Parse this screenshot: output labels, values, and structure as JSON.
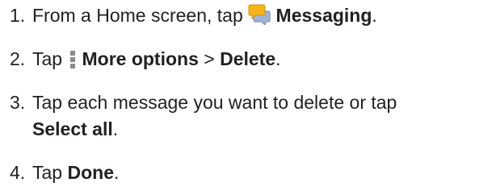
{
  "steps": [
    {
      "number": "1.",
      "text_before": "From a Home screen, tap",
      "icon": "messaging-icon",
      "bold": "Messaging",
      "text_after": "."
    },
    {
      "number": "2.",
      "text_before": "Tap",
      "icon": "more-options-icon",
      "bold": "More options",
      "separator": ">",
      "bold2": "Delete",
      "text_after": "."
    },
    {
      "number": "3.",
      "text_before": "Tap each message you want to delete or tap",
      "bold": "Select all",
      "text_after": "."
    },
    {
      "number": "4.",
      "text_before": "Tap",
      "bold": "Done",
      "text_after": "."
    }
  ],
  "colors": {
    "text": "#231f20",
    "messaging_icon_yellow": "#f6b21a",
    "messaging_icon_blue": "#9fb5d8",
    "more_options_gray": "#8a8a8a"
  }
}
